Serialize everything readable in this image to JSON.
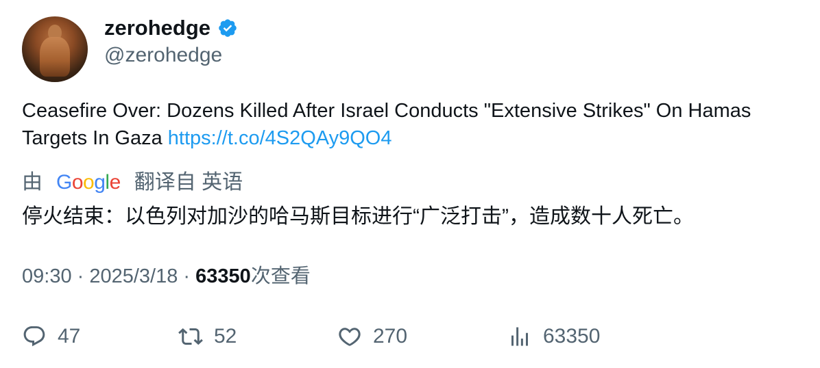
{
  "author": {
    "display_name": "zerohedge",
    "handle": "@zerohedge",
    "verified_icon": "verified-badge-icon",
    "avatar_icon": "avatar-image"
  },
  "tweet": {
    "text": "Ceasefire Over: Dozens Killed After Israel Conducts \"Extensive Strikes\" On Hamas Targets In Gaza ",
    "link": "https://t.co/4S2QAy9QO4"
  },
  "translation": {
    "prefix": "由",
    "provider": "Google",
    "suffix": "翻译自 英语",
    "text": "停火结束：以色列对加沙的哈马斯目标进行“广泛打击”，造成数十人死亡。"
  },
  "meta": {
    "time": "09:30",
    "separator": " · ",
    "date": "2025/3/18",
    "views_count": "63350",
    "views_label": "次查看"
  },
  "actions": {
    "replies": "47",
    "retweets": "52",
    "likes": "270",
    "views": "63350"
  },
  "colors": {
    "accent": "#1d9bf0",
    "secondary_text": "#536471",
    "primary_text": "#0f1419"
  }
}
